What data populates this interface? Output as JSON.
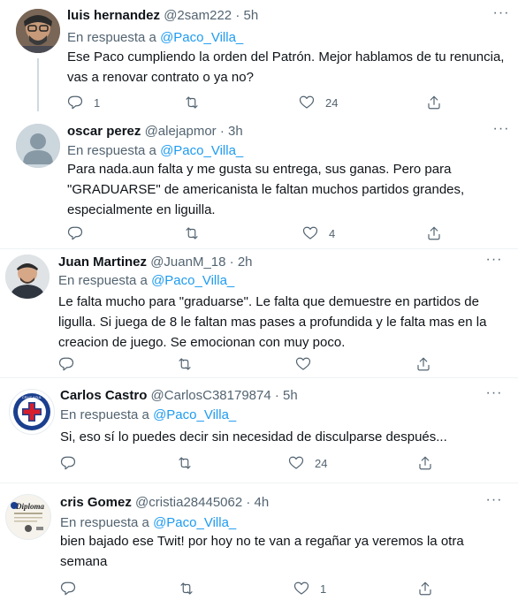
{
  "tweets": [
    {
      "name": "luis hernandez",
      "handle": "@2sam222",
      "time": "5h",
      "reply_label": "En respuesta a",
      "reply_to": "@Paco_Villa_",
      "text": "Ese Paco cumpliendo la orden del Patrón. Mejor hablamos de tu renuncia, vas a renovar contrato o ya no?",
      "replies": "1",
      "retweets": "",
      "likes": "24"
    },
    {
      "name": "oscar perez",
      "handle": "@alejapmor",
      "time": "3h",
      "reply_label": "En respuesta a",
      "reply_to": "@Paco_Villa_",
      "text": "Para nada.aun falta y me gusta su entrega, sus ganas. Pero para \"GRADUARSE\" de americanista le faltan muchos partidos grandes, especialmente en liguilla.",
      "replies": "",
      "retweets": "",
      "likes": "4"
    },
    {
      "name": "Juan Martinez",
      "handle": "@JuanM_18",
      "time": "2h",
      "reply_label": "En respuesta a",
      "reply_to": "@Paco_Villa_",
      "text": "Le falta mucho para \"graduarse\". Le falta que demuestre en partidos de ligulla. Si juega de 8 le faltan mas pases a profundida y le falta mas en la creacion de juego. Se emocionan con muy poco.",
      "replies": "",
      "retweets": "",
      "likes": ""
    },
    {
      "name": "Carlos Castro",
      "handle": "@CarlosC38179874",
      "time": "5h",
      "reply_label": "En respuesta a",
      "reply_to": "@Paco_Villa_",
      "text": "Si, eso sí lo puedes decir sin necesidad de disculparse después...",
      "replies": "",
      "retweets": "",
      "likes": "24"
    },
    {
      "name": "cris Gomez",
      "handle": "@cristia28445062",
      "time": "4h",
      "reply_label": "En respuesta a",
      "reply_to": "@Paco_Villa_",
      "text": "bien bajado ese Twit! por hoy no te van a regañar ya veremos la otra semana",
      "replies": "",
      "retweets": "",
      "likes": "1"
    }
  ],
  "avatar_texts": {
    "carlos_logo": "CRUZ AZUL",
    "cris_diploma": "Diploma"
  },
  "colors": {
    "link": "#1d9bf0",
    "secondary": "#536471",
    "separator": "#eff3f4"
  },
  "icons": {
    "reply": "reply-icon",
    "retweet": "retweet-icon",
    "like": "heart-icon",
    "share": "share-icon",
    "more": "more-icon"
  }
}
